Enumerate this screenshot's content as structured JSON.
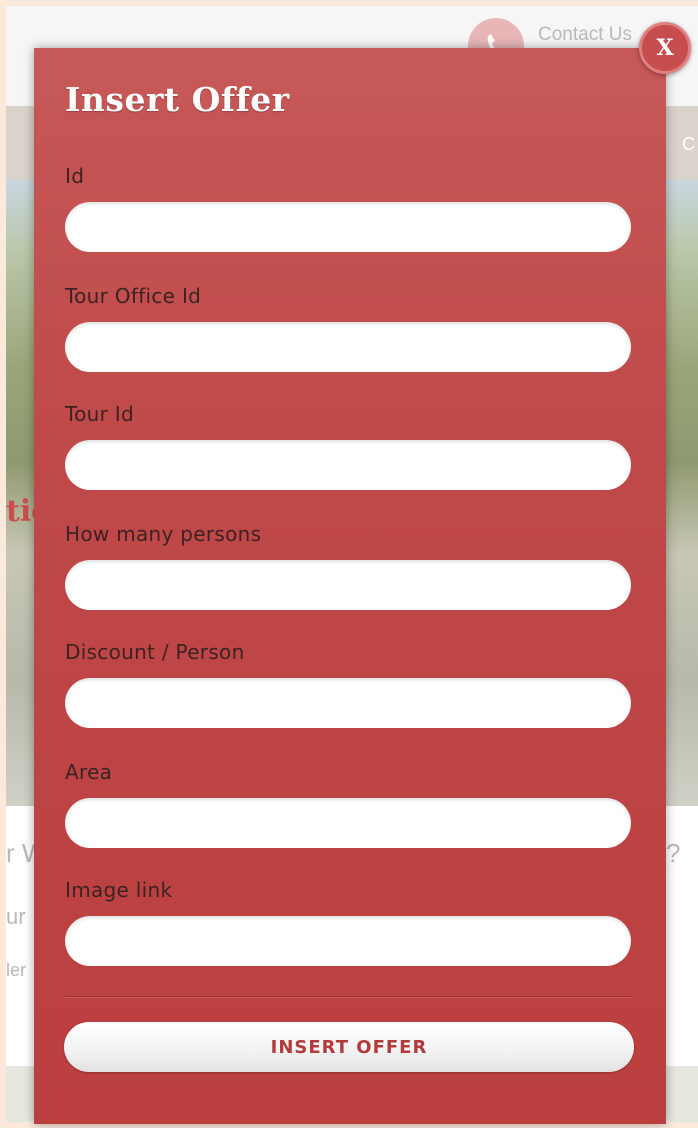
{
  "background": {
    "contact_label": "Contact Us",
    "nav_partial": "C",
    "hero_partial": "tic",
    "section_partial": "r W",
    "section_partial_end": "?",
    "line2_partial": "ur",
    "line3_partial": "ler"
  },
  "modal": {
    "title": "Insert Offer",
    "close_label": "X",
    "fields": [
      {
        "label": "Id",
        "value": "",
        "placeholder": ""
      },
      {
        "label": "Tour Office Id",
        "value": "",
        "placeholder": ""
      },
      {
        "label": "Tour Id",
        "value": "",
        "placeholder": ""
      },
      {
        "label": "How many persons",
        "value": "",
        "placeholder": ""
      },
      {
        "label": "Discount / Person",
        "value": "",
        "placeholder": ""
      },
      {
        "label": "Area",
        "value": "",
        "placeholder": ""
      },
      {
        "label": "Image link",
        "value": "",
        "placeholder": ""
      }
    ],
    "submit_label": "INSERT OFFER"
  },
  "colors": {
    "modal_red": "#bf4848",
    "page_background": "#fbe9dc",
    "button_text": "#b33a3a"
  },
  "icons": [
    "phone-icon",
    "close-icon"
  ]
}
